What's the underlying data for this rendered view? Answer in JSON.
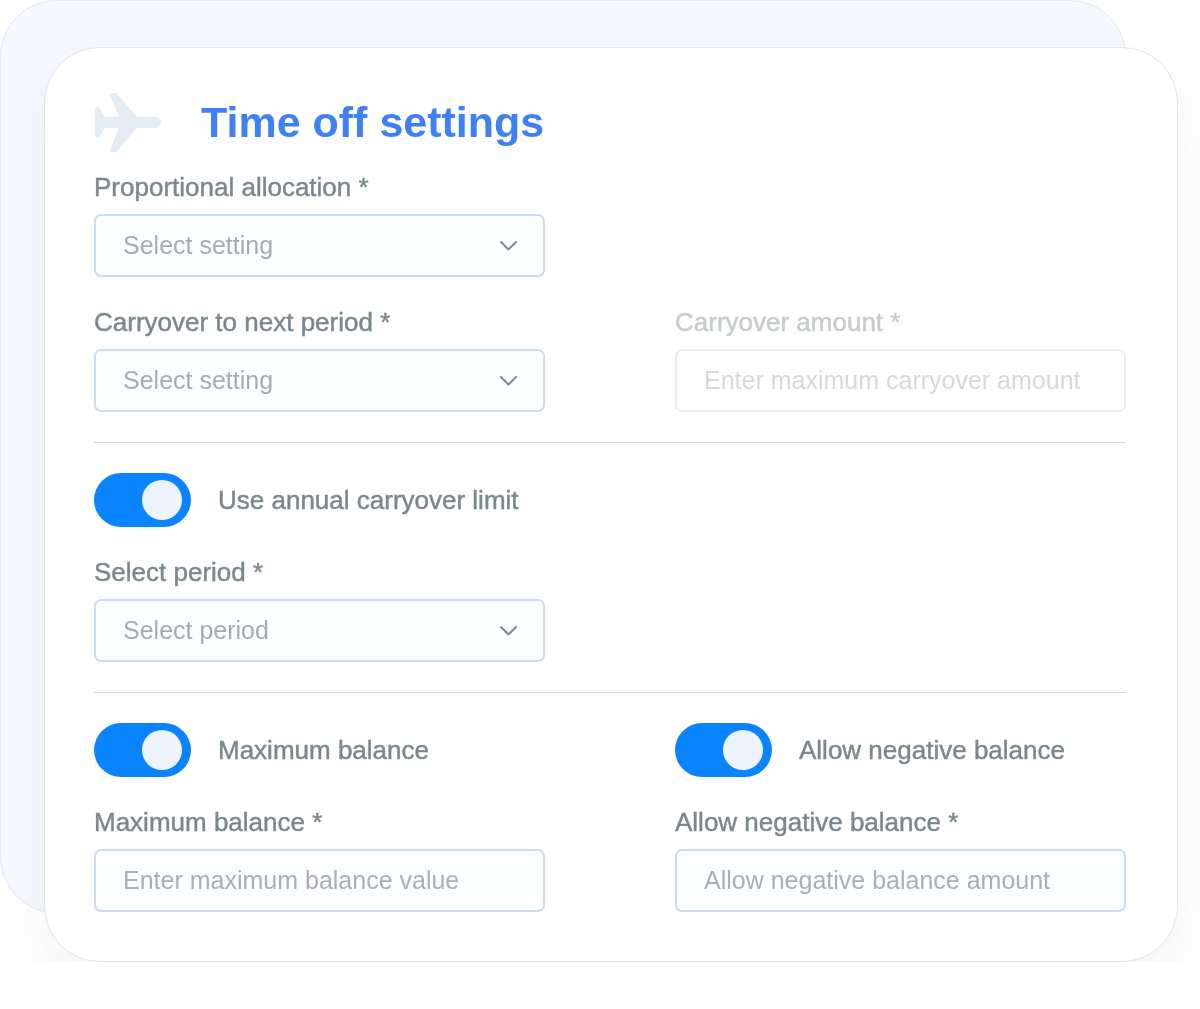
{
  "header": {
    "title": "Time off settings"
  },
  "rows": [
    {
      "kind": "fields",
      "fields": [
        {
          "kind": "select",
          "label": "Proportional allocation *",
          "placeholder": "Select setting",
          "disabled": false
        }
      ]
    },
    {
      "kind": "fields",
      "fields": [
        {
          "kind": "select",
          "label": "Carryover to next period *",
          "placeholder": "Select setting",
          "disabled": false
        },
        {
          "kind": "text",
          "label": "Carryover amount *",
          "placeholder": "Enter maximum carryover amount",
          "disabled": true
        }
      ]
    },
    {
      "kind": "divider"
    },
    {
      "kind": "toggles",
      "toggles": [
        {
          "label": "Use annual carryover limit",
          "on": true
        }
      ]
    },
    {
      "kind": "fields",
      "fields": [
        {
          "kind": "select",
          "label": "Select period *",
          "placeholder": "Select period",
          "disabled": false
        }
      ]
    },
    {
      "kind": "divider"
    },
    {
      "kind": "toggles",
      "toggles": [
        {
          "label": "Maximum balance",
          "on": true
        },
        {
          "label": "Allow negative balance",
          "on": true
        }
      ]
    },
    {
      "kind": "fields",
      "fields": [
        {
          "kind": "text",
          "label": "Maximum balance *",
          "placeholder": "Enter maximum balance value",
          "disabled": false
        },
        {
          "kind": "text",
          "label": "Allow negative balance *",
          "placeholder": "Allow negative balance amount",
          "disabled": false
        }
      ]
    }
  ]
}
